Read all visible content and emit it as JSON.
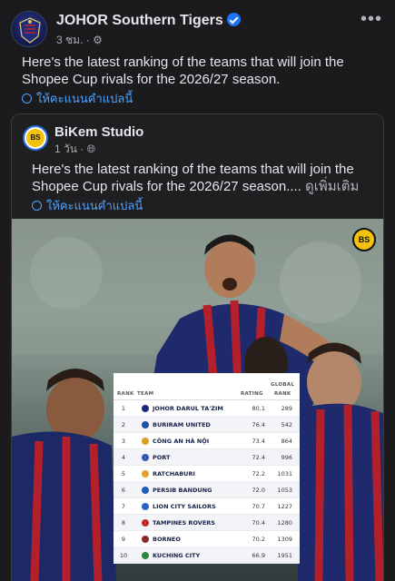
{
  "post": {
    "page_name": "JOHOR Southern Tigers",
    "time": "3 ชม.",
    "privacy_icon": "gear-icon",
    "text": "Here's the latest ranking of the teams that will join the Shopee Cup rivals for the 2026/27 season.",
    "see_translation": "ให้คะแนนคำแปลนี้"
  },
  "shared": {
    "page_name": "BiKem Studio",
    "avatar_text": "BS",
    "time": "1 วัน",
    "privacy_icon": "globe-icon",
    "text": "Here's the latest ranking of the teams that will join the Shopee Cup rivals for the 2026/27 season....",
    "see_more": "ดูเพิ่มเติม",
    "see_translation": "ให้คะแนนคำแปลนี้",
    "photo_logo": "BS"
  },
  "table": {
    "headers": {
      "rank": "RANK",
      "team": "TEAM",
      "rating": "RATING",
      "global_line1": "GLOBAL",
      "global_line2": "RANK"
    },
    "rows": [
      {
        "rank": "1",
        "team": "JOHOR DARUL TA'ZIM",
        "rating": "80.1",
        "global": "289",
        "color": "#1c2a7a"
      },
      {
        "rank": "2",
        "team": "BURIRAM UNITED",
        "rating": "76.4",
        "global": "542",
        "color": "#1f4fa8"
      },
      {
        "rank": "3",
        "team": "CÔNG AN HÀ NỘI",
        "rating": "73.4",
        "global": "864",
        "color": "#d9a21b"
      },
      {
        "rank": "4",
        "team": "PORT",
        "rating": "72.4",
        "global": "996",
        "color": "#3a57b8"
      },
      {
        "rank": "5",
        "team": "RATCHABURI",
        "rating": "72.2",
        "global": "1031",
        "color": "#e0a030"
      },
      {
        "rank": "6",
        "team": "PERSIB BANDUNG",
        "rating": "72.0",
        "global": "1053",
        "color": "#1e5db8"
      },
      {
        "rank": "7",
        "team": "LION CITY SAILORS",
        "rating": "70.7",
        "global": "1227",
        "color": "#2b63c9"
      },
      {
        "rank": "8",
        "team": "TAMPINES ROVERS",
        "rating": "70.4",
        "global": "1280",
        "color": "#c22a2a"
      },
      {
        "rank": "9",
        "team": "BORNEO",
        "rating": "70.2",
        "global": "1309",
        "color": "#8a2c2c"
      },
      {
        "rank": "10",
        "team": "KUCHING CITY",
        "rating": "66.9",
        "global": "1951",
        "color": "#2a8a3a"
      }
    ]
  }
}
